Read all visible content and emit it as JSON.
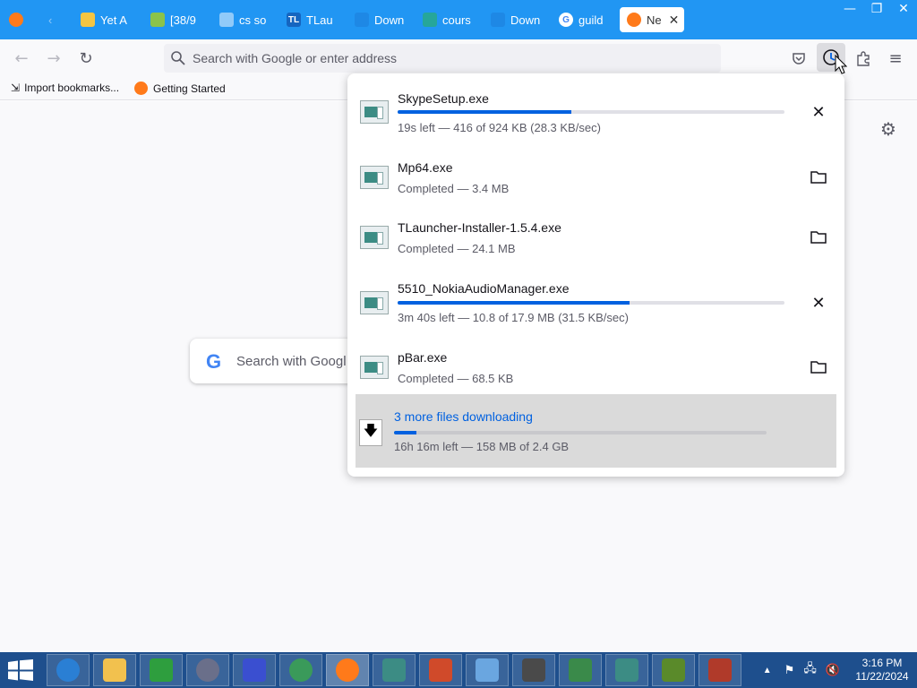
{
  "browser": {
    "tabs": [
      {
        "label": "Yet A",
        "color": "#f5c542"
      },
      {
        "label": "[38/9",
        "color": "#8bc34a"
      },
      {
        "label": "cs so",
        "color": "#90caf9"
      },
      {
        "label": "TLau",
        "color": "#1565c0"
      },
      {
        "label": "Down",
        "color": "#1e88e5"
      },
      {
        "label": "cours",
        "color": "#26a69a"
      },
      {
        "label": "Down",
        "color": "#1e88e5"
      },
      {
        "label": "guild",
        "color": "#ffffff"
      }
    ],
    "active_tab": {
      "label": "Ne",
      "close": "✕"
    },
    "window_controls": {
      "minimize": "—",
      "restore": "❐",
      "close": "✕"
    },
    "address_placeholder": "Search with Google or enter address",
    "bookmarks": [
      {
        "label": "Import bookmarks..."
      },
      {
        "label": "Getting Started"
      }
    ]
  },
  "newtab": {
    "search_placeholder": "Search with Googl"
  },
  "downloads": {
    "items": [
      {
        "name": "SkypeSetup.exe",
        "status": "19s left — 416 of 924 KB (28.3 KB/sec)",
        "progress": 0.45,
        "action": "cancel",
        "in_progress": true
      },
      {
        "name": "Mp64.exe",
        "status": "Completed — 3.4 MB",
        "action": "show-in-folder",
        "in_progress": false
      },
      {
        "name": "TLauncher-Installer-1.5.4.exe",
        "status": "Completed — 24.1 MB",
        "action": "show-in-folder",
        "in_progress": false
      },
      {
        "name": "5510_NokiaAudioManager.exe",
        "status": "3m 40s left — 10.8 of 17.9 MB (31.5 KB/sec)",
        "progress": 0.6,
        "action": "cancel",
        "in_progress": true
      },
      {
        "name": "pBar.exe",
        "status": "Completed — 68.5 KB",
        "action": "show-in-folder",
        "in_progress": false
      }
    ],
    "summary": {
      "label": "3 more files downloading",
      "status": "16h 16m left — 158 MB of 2.4 GB",
      "progress": 0.06
    }
  },
  "taskbar": {
    "clock_time": "3:16 PM",
    "clock_date": "11/22/2024",
    "apps": [
      {
        "name": "internet-explorer",
        "color": "#2a7fd4"
      },
      {
        "name": "file-explorer",
        "color": "#f2c14e"
      },
      {
        "name": "store",
        "color": "#2e9e3e"
      },
      {
        "name": "media-sphere",
        "color": "#6a6f8a"
      },
      {
        "name": "paint-drop",
        "color": "#3a4fd0"
      },
      {
        "name": "globe-app",
        "color": "#3a9a5a"
      },
      {
        "name": "firefox",
        "color": "#ff7a1a"
      },
      {
        "name": "installer",
        "color": "#3c8c84"
      },
      {
        "name": "office-tiles",
        "color": "#d04a2a"
      },
      {
        "name": "network-app",
        "color": "#6aa6e0"
      },
      {
        "name": "css-game",
        "color": "#4a4a4a"
      },
      {
        "name": "monitor-app",
        "color": "#3a8a4a"
      },
      {
        "name": "installer-2",
        "color": "#3c8c84"
      },
      {
        "name": "minecraft",
        "color": "#5a8a2a"
      },
      {
        "name": "spartan-app",
        "color": "#b03a2a"
      }
    ]
  }
}
